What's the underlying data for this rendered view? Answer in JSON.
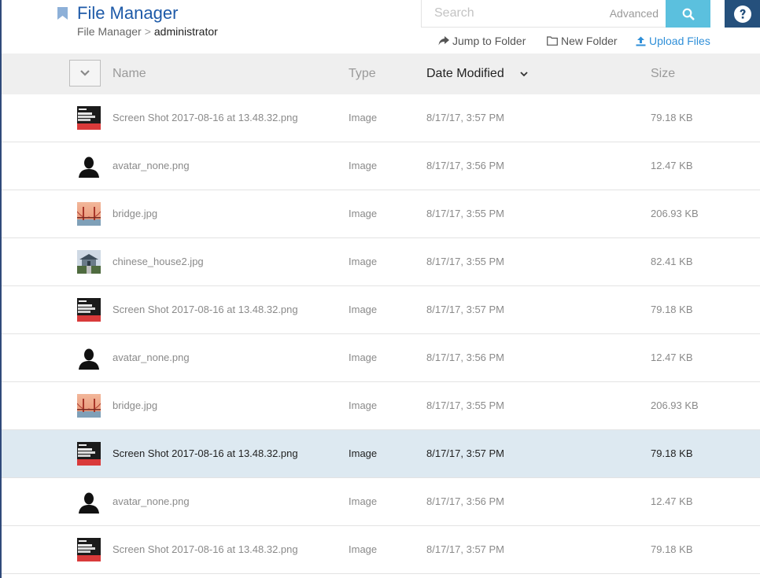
{
  "header": {
    "title": "File Manager",
    "breadcrumb": {
      "root": "File Manager",
      "separator": ">",
      "current": "administrator"
    }
  },
  "search": {
    "placeholder": "Search",
    "value": "",
    "advanced_label": "Advanced"
  },
  "actions": {
    "jump_to_folder": "Jump to Folder",
    "new_folder": "New Folder",
    "upload_files": "Upload Files"
  },
  "table": {
    "columns": {
      "name": "Name",
      "type": "Type",
      "date_modified": "Date Modified",
      "size": "Size"
    },
    "sorted_by": "date_modified",
    "rows": [
      {
        "name": "Screen Shot 2017-08-16 at 13.48.32.png",
        "type": "Image",
        "date": "8/17/17, 3:57 PM",
        "size": "79.18 KB",
        "thumb": "screenshot",
        "selected": false
      },
      {
        "name": "avatar_none.png",
        "type": "Image",
        "date": "8/17/17, 3:56 PM",
        "size": "12.47 KB",
        "thumb": "avatar",
        "selected": false
      },
      {
        "name": "bridge.jpg",
        "type": "Image",
        "date": "8/17/17, 3:55 PM",
        "size": "206.93 KB",
        "thumb": "bridge",
        "selected": false
      },
      {
        "name": "chinese_house2.jpg",
        "type": "Image",
        "date": "8/17/17, 3:55 PM",
        "size": "82.41 KB",
        "thumb": "house",
        "selected": false
      },
      {
        "name": "Screen Shot 2017-08-16 at 13.48.32.png",
        "type": "Image",
        "date": "8/17/17, 3:57 PM",
        "size": "79.18 KB",
        "thumb": "screenshot",
        "selected": false
      },
      {
        "name": "avatar_none.png",
        "type": "Image",
        "date": "8/17/17, 3:56 PM",
        "size": "12.47 KB",
        "thumb": "avatar",
        "selected": false
      },
      {
        "name": "bridge.jpg",
        "type": "Image",
        "date": "8/17/17, 3:55 PM",
        "size": "206.93 KB",
        "thumb": "bridge",
        "selected": false
      },
      {
        "name": "Screen Shot 2017-08-16 at 13.48.32.png",
        "type": "Image",
        "date": "8/17/17, 3:57 PM",
        "size": "79.18 KB",
        "thumb": "screenshot",
        "selected": true
      },
      {
        "name": "avatar_none.png",
        "type": "Image",
        "date": "8/17/17, 3:56 PM",
        "size": "12.47 KB",
        "thumb": "avatar",
        "selected": false
      },
      {
        "name": "Screen Shot 2017-08-16 at 13.48.32.png",
        "type": "Image",
        "date": "8/17/17, 3:57 PM",
        "size": "79.18 KB",
        "thumb": "screenshot",
        "selected": false
      }
    ]
  },
  "icons": {
    "bookmark": "bookmark-icon",
    "search": "search-icon",
    "help": "help-icon",
    "jump": "share-arrow-icon",
    "folder": "folder-icon",
    "upload": "upload-icon",
    "select_all": "chevron-down-icon",
    "sort": "chevron-down-icon"
  },
  "colors": {
    "title": "#1e5aa8",
    "search_button": "#5bc0de",
    "help_button": "#25507c",
    "upload_link": "#2f8fd8",
    "selected_row": "#dde9f1",
    "table_header": "#efefef"
  }
}
